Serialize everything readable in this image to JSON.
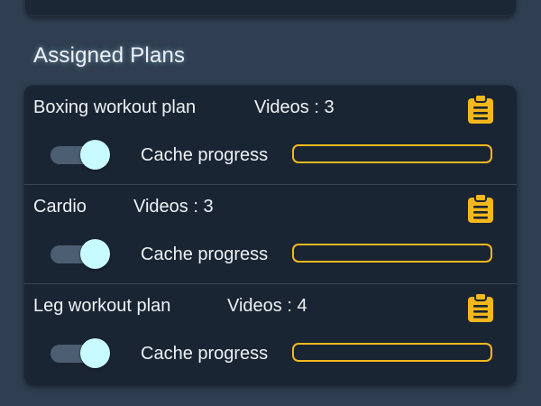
{
  "section": {
    "title": "Assigned Plans"
  },
  "plans": [
    {
      "name": "Boxing workout plan",
      "videos": "Videos : 3",
      "cache_label": "Cache progress",
      "cache_progress": 0,
      "cache_enabled": true
    },
    {
      "name": "Cardio",
      "videos": "Videos : 3",
      "cache_label": "Cache progress",
      "cache_progress": 0,
      "cache_enabled": true
    },
    {
      "name": "Leg workout plan",
      "videos": "Videos : 4",
      "cache_label": "Cache progress",
      "cache_progress": 0,
      "cache_enabled": true
    }
  ],
  "colors": {
    "accent": "#f4b81c",
    "toggle_thumb": "#c8fbff",
    "card_bg": "#1a2533",
    "page_bg": "#2f3f51"
  },
  "icons": {
    "plan_action": "clipboard-icon"
  }
}
